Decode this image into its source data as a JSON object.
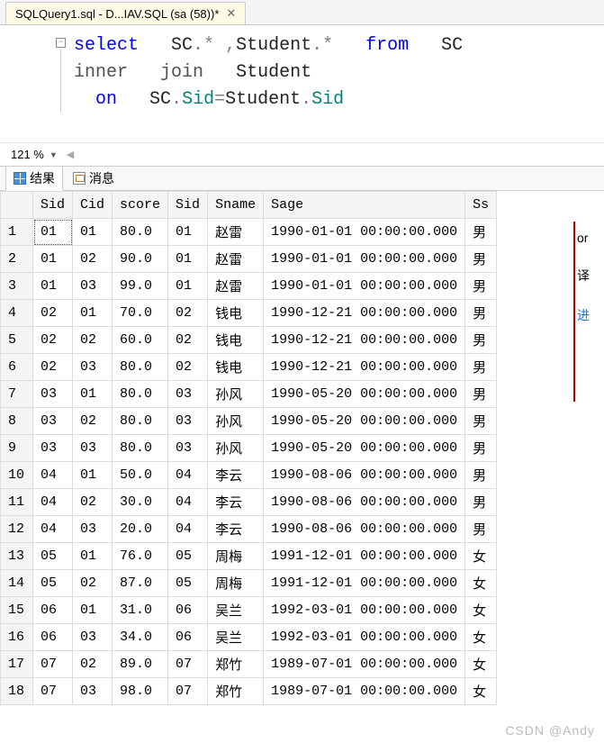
{
  "tab": {
    "title": "SQLQuery1.sql - D...IAV.SQL (sa (58))*",
    "close": "✕"
  },
  "code": {
    "tokens": {
      "select": "select",
      "sc": "SC",
      "dotstar": ".*",
      "comma": ",",
      "student": "Student",
      "from": "from",
      "inner": "inner",
      "join": "join",
      "on": "on",
      "dot": ".",
      "sid": "Sid",
      "eq": "="
    }
  },
  "zoom": {
    "level": "121 %"
  },
  "result_tabs": {
    "results": "结果",
    "messages": "消息"
  },
  "columns": [
    "Sid",
    "Cid",
    "score",
    "Sid",
    "Sname",
    "Sage",
    "Ss"
  ],
  "rows": [
    {
      "n": "1",
      "Sid": "01",
      "Cid": "01",
      "score": "80.0",
      "Sid2": "01",
      "Sname": "赵雷",
      "Sage": "1990-01-01 00:00:00.000",
      "Ss": "男"
    },
    {
      "n": "2",
      "Sid": "01",
      "Cid": "02",
      "score": "90.0",
      "Sid2": "01",
      "Sname": "赵雷",
      "Sage": "1990-01-01 00:00:00.000",
      "Ss": "男"
    },
    {
      "n": "3",
      "Sid": "01",
      "Cid": "03",
      "score": "99.0",
      "Sid2": "01",
      "Sname": "赵雷",
      "Sage": "1990-01-01 00:00:00.000",
      "Ss": "男"
    },
    {
      "n": "4",
      "Sid": "02",
      "Cid": "01",
      "score": "70.0",
      "Sid2": "02",
      "Sname": "钱电",
      "Sage": "1990-12-21 00:00:00.000",
      "Ss": "男"
    },
    {
      "n": "5",
      "Sid": "02",
      "Cid": "02",
      "score": "60.0",
      "Sid2": "02",
      "Sname": "钱电",
      "Sage": "1990-12-21 00:00:00.000",
      "Ss": "男"
    },
    {
      "n": "6",
      "Sid": "02",
      "Cid": "03",
      "score": "80.0",
      "Sid2": "02",
      "Sname": "钱电",
      "Sage": "1990-12-21 00:00:00.000",
      "Ss": "男"
    },
    {
      "n": "7",
      "Sid": "03",
      "Cid": "01",
      "score": "80.0",
      "Sid2": "03",
      "Sname": "孙风",
      "Sage": "1990-05-20 00:00:00.000",
      "Ss": "男"
    },
    {
      "n": "8",
      "Sid": "03",
      "Cid": "02",
      "score": "80.0",
      "Sid2": "03",
      "Sname": "孙风",
      "Sage": "1990-05-20 00:00:00.000",
      "Ss": "男"
    },
    {
      "n": "9",
      "Sid": "03",
      "Cid": "03",
      "score": "80.0",
      "Sid2": "03",
      "Sname": "孙风",
      "Sage": "1990-05-20 00:00:00.000",
      "Ss": "男"
    },
    {
      "n": "10",
      "Sid": "04",
      "Cid": "01",
      "score": "50.0",
      "Sid2": "04",
      "Sname": "李云",
      "Sage": "1990-08-06 00:00:00.000",
      "Ss": "男"
    },
    {
      "n": "11",
      "Sid": "04",
      "Cid": "02",
      "score": "30.0",
      "Sid2": "04",
      "Sname": "李云",
      "Sage": "1990-08-06 00:00:00.000",
      "Ss": "男"
    },
    {
      "n": "12",
      "Sid": "04",
      "Cid": "03",
      "score": "20.0",
      "Sid2": "04",
      "Sname": "李云",
      "Sage": "1990-08-06 00:00:00.000",
      "Ss": "男"
    },
    {
      "n": "13",
      "Sid": "05",
      "Cid": "01",
      "score": "76.0",
      "Sid2": "05",
      "Sname": "周梅",
      "Sage": "1991-12-01 00:00:00.000",
      "Ss": "女"
    },
    {
      "n": "14",
      "Sid": "05",
      "Cid": "02",
      "score": "87.0",
      "Sid2": "05",
      "Sname": "周梅",
      "Sage": "1991-12-01 00:00:00.000",
      "Ss": "女"
    },
    {
      "n": "15",
      "Sid": "06",
      "Cid": "01",
      "score": "31.0",
      "Sid2": "06",
      "Sname": "吴兰",
      "Sage": "1992-03-01 00:00:00.000",
      "Ss": "女"
    },
    {
      "n": "16",
      "Sid": "06",
      "Cid": "03",
      "score": "34.0",
      "Sid2": "06",
      "Sname": "吴兰",
      "Sage": "1992-03-01 00:00:00.000",
      "Ss": "女"
    },
    {
      "n": "17",
      "Sid": "07",
      "Cid": "02",
      "score": "89.0",
      "Sid2": "07",
      "Sname": "郑竹",
      "Sage": "1989-07-01 00:00:00.000",
      "Ss": "女"
    },
    {
      "n": "18",
      "Sid": "07",
      "Cid": "03",
      "score": "98.0",
      "Sid2": "07",
      "Sname": "郑竹",
      "Sage": "1989-07-01 00:00:00.000",
      "Ss": "女"
    }
  ],
  "side": {
    "t1": "or",
    "t2": "译",
    "t3": "进"
  },
  "watermark": "CSDN @Andy"
}
